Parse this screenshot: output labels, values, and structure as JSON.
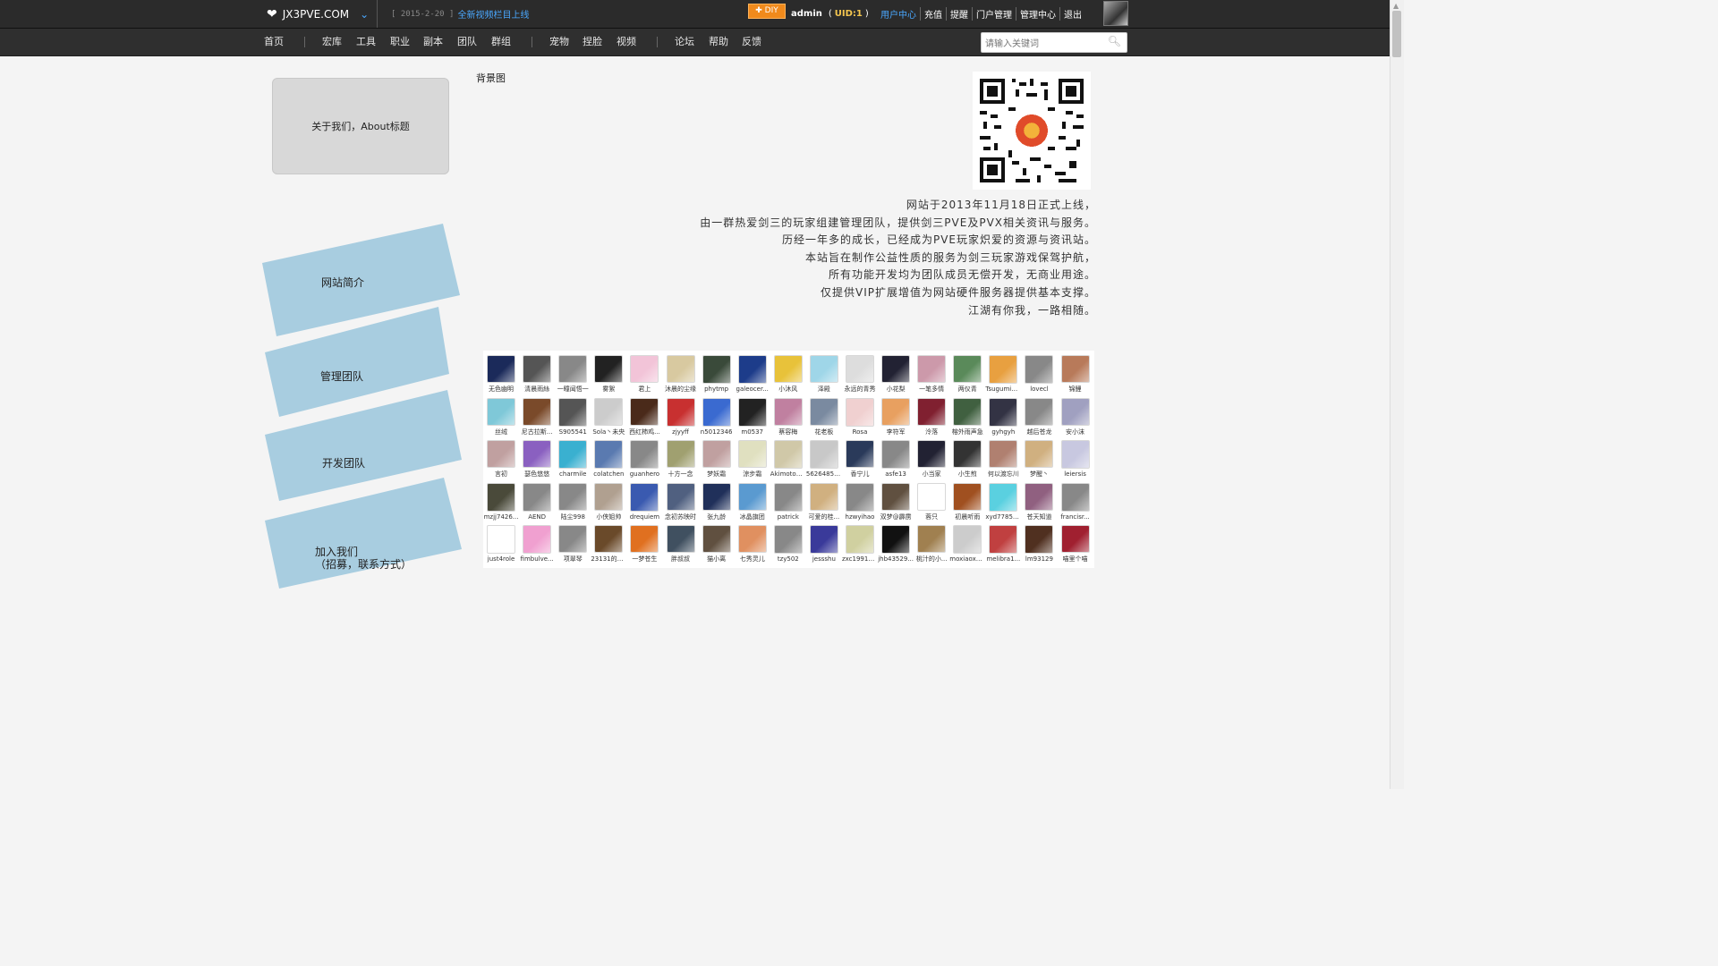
{
  "topbar": {
    "site_name": "JX3PVE.COM",
    "news_date": "[ 2015-2-20 ]",
    "news_link": "全新视频栏目上线",
    "diy_label": "DIY",
    "username": "admin",
    "uid_text": "UID:1",
    "menu": [
      "用户中心",
      "充值",
      "提醒",
      "门户管理",
      "管理中心",
      "退出"
    ]
  },
  "nav": {
    "items": [
      "首页",
      "宏库",
      "工具",
      "职业",
      "副本",
      "团队",
      "群组",
      "宠物",
      "捏脸",
      "视频",
      "论坛",
      "帮助",
      "反馈"
    ],
    "search_placeholder": "请输入关键词"
  },
  "sidebar": {
    "about_title": "关于我们，About标题",
    "cards": [
      "网站简介",
      "管理团队",
      "开发团队",
      "加入我们\n（招募，联系方式）"
    ]
  },
  "main": {
    "bg_label": "背景图",
    "intro_lines": [
      "网站于2013年11月18日正式上线，",
      "由一群热爱剑三的玩家组建管理团队，提供剑三PVE及PVX相关资讯与服务。",
      "历经一年多的成长，已经成为PVE玩家炽爱的资源与资讯站。",
      "本站旨在制作公益性质的服务为剑三玩家游戏保驾护航，",
      "所有功能开发均为团队成员无偿开发，无商业用途。",
      "仅提供VIP扩展增值为网站硬件服务器提供基本支撑。",
      "江湖有你我，一路相随。"
    ]
  },
  "members": [
    {
      "name": "无色幽明",
      "color": "#1b2a5a"
    },
    {
      "name": "清晨雨絲",
      "color": "#555"
    },
    {
      "name": "一瞳闻悟一",
      "color": "#888"
    },
    {
      "name": "雾絮",
      "color": "#222"
    },
    {
      "name": "君上",
      "color": "#f2c4d8"
    },
    {
      "name": "沐晨的尘缘",
      "color": "#d8c9a0"
    },
    {
      "name": "phytmp",
      "color": "#3a4a3a"
    },
    {
      "name": "galeocer...",
      "color": "#1d3c8a"
    },
    {
      "name": "小沐风",
      "color": "#e8c23a"
    },
    {
      "name": "泽殿",
      "color": "#9fd6e8"
    },
    {
      "name": "永远的青秀",
      "color": "#ddd"
    },
    {
      "name": "小花梨",
      "color": "#223"
    },
    {
      "name": "一笔多情",
      "color": "#c9a"
    },
    {
      "name": "两仪青",
      "color": "#5a8a5a"
    },
    {
      "name": "Tsugumi@...",
      "color": "#e8a040"
    },
    {
      "name": "lovecl",
      "color": "#888"
    },
    {
      "name": "锦鲤",
      "color": "#b87a5a"
    },
    {
      "name": "丝绒",
      "color": "#7fc8d8"
    },
    {
      "name": "尼古拉斯...",
      "color": "#7a4a2a"
    },
    {
      "name": "S905541",
      "color": "#555"
    },
    {
      "name": "Sola丶未央",
      "color": "#ccc"
    },
    {
      "name": "西红柿鸡...",
      "color": "#4a2a1a"
    },
    {
      "name": "zjyyff",
      "color": "#c83030"
    },
    {
      "name": "n5012346",
      "color": "#3a6ad0"
    },
    {
      "name": "m0537",
      "color": "#222"
    },
    {
      "name": "蔡容梅",
      "color": "#c080a0"
    },
    {
      "name": "花老板",
      "color": "#7a8aa0"
    },
    {
      "name": "Rosa",
      "color": "#f0d0d0"
    },
    {
      "name": "李符军",
      "color": "#e8a060"
    },
    {
      "name": "泠落",
      "color": "#802030"
    },
    {
      "name": "榕外雨声急",
      "color": "#406040"
    },
    {
      "name": "gyhgyh",
      "color": "#334"
    },
    {
      "name": "越后苍龙",
      "color": "#888"
    },
    {
      "name": "安小沫",
      "color": "#a0a0c0"
    },
    {
      "name": "言初",
      "color": "#c0a0a0"
    },
    {
      "name": "瑟色悠悠",
      "color": "#8a60c0"
    },
    {
      "name": "charmile",
      "color": "#3ab0d0"
    },
    {
      "name": "colatchen",
      "color": "#5a7ab0"
    },
    {
      "name": "guanhero",
      "color": "#888"
    },
    {
      "name": "十方一念",
      "color": "#a0a070"
    },
    {
      "name": "梦妖霜",
      "color": "#c0a0a0"
    },
    {
      "name": "涼步霜",
      "color": "#e0e0c0"
    },
    {
      "name": "AkimotoA...",
      "color": "#d0c8a8"
    },
    {
      "name": "562648551",
      "color": "#c8c8c8"
    },
    {
      "name": "香宁儿",
      "color": "#2a3a5a"
    },
    {
      "name": "asfe13",
      "color": "#888"
    },
    {
      "name": "小当家",
      "color": "#223"
    },
    {
      "name": "小生煎",
      "color": "#333"
    },
    {
      "name": "何以渡忘川",
      "color": "#b08070"
    },
    {
      "name": "梦醒丶",
      "color": "#d0b080"
    },
    {
      "name": "leiersis",
      "color": "#c8c8e0"
    },
    {
      "name": "mzjj7426...",
      "color": "#4a4a3a"
    },
    {
      "name": "AEND",
      "color": "#888"
    },
    {
      "name": "陆尘998",
      "color": "#888"
    },
    {
      "name": "小侠姐帅",
      "color": "#b0a090"
    },
    {
      "name": "drequiem",
      "color": "#3a5ab0"
    },
    {
      "name": "念初苏映时",
      "color": "#506080"
    },
    {
      "name": "张九龄",
      "color": "#20305a"
    },
    {
      "name": "冰晶旗团",
      "color": "#5a9ad0"
    },
    {
      "name": "patrick",
      "color": "#888"
    },
    {
      "name": "可爱的桂...",
      "color": "#d0b080"
    },
    {
      "name": "hzwyihao",
      "color": "#888"
    },
    {
      "name": "双梦@霹雳",
      "color": "#605040"
    },
    {
      "name": "蓉只",
      "color": "#fff"
    },
    {
      "name": "初晨听雨",
      "color": "#a05020"
    },
    {
      "name": "xyd77852...",
      "color": "#5ad0e0"
    },
    {
      "name": "苍天知道",
      "color": "#906080"
    },
    {
      "name": "francisr...",
      "color": "#888"
    },
    {
      "name": "just4role",
      "color": "#fff"
    },
    {
      "name": "fimbulve...",
      "color": "#f0a0d0"
    },
    {
      "name": "项翠琴",
      "color": "#888"
    },
    {
      "name": "23131的3...",
      "color": "#6a4a2a"
    },
    {
      "name": "一梦苍生",
      "color": "#e07020"
    },
    {
      "name": "胖叔叔",
      "color": "#405060"
    },
    {
      "name": "猫小离",
      "color": "#605040"
    },
    {
      "name": "七秀灵儿",
      "color": "#e09060"
    },
    {
      "name": "tzy502",
      "color": "#888"
    },
    {
      "name": "jessshu",
      "color": "#3a3a9a"
    },
    {
      "name": "zxc19911...",
      "color": "#d0d0a0"
    },
    {
      "name": "jhb43529...",
      "color": "#111"
    },
    {
      "name": "桃汁的小...",
      "color": "#a08050"
    },
    {
      "name": "moxiaoxu...",
      "color": "#ccc"
    },
    {
      "name": "melibra1...",
      "color": "#c04040"
    },
    {
      "name": "lm93129",
      "color": "#503020"
    },
    {
      "name": "喵里个喵",
      "color": "#a02030"
    }
  ]
}
